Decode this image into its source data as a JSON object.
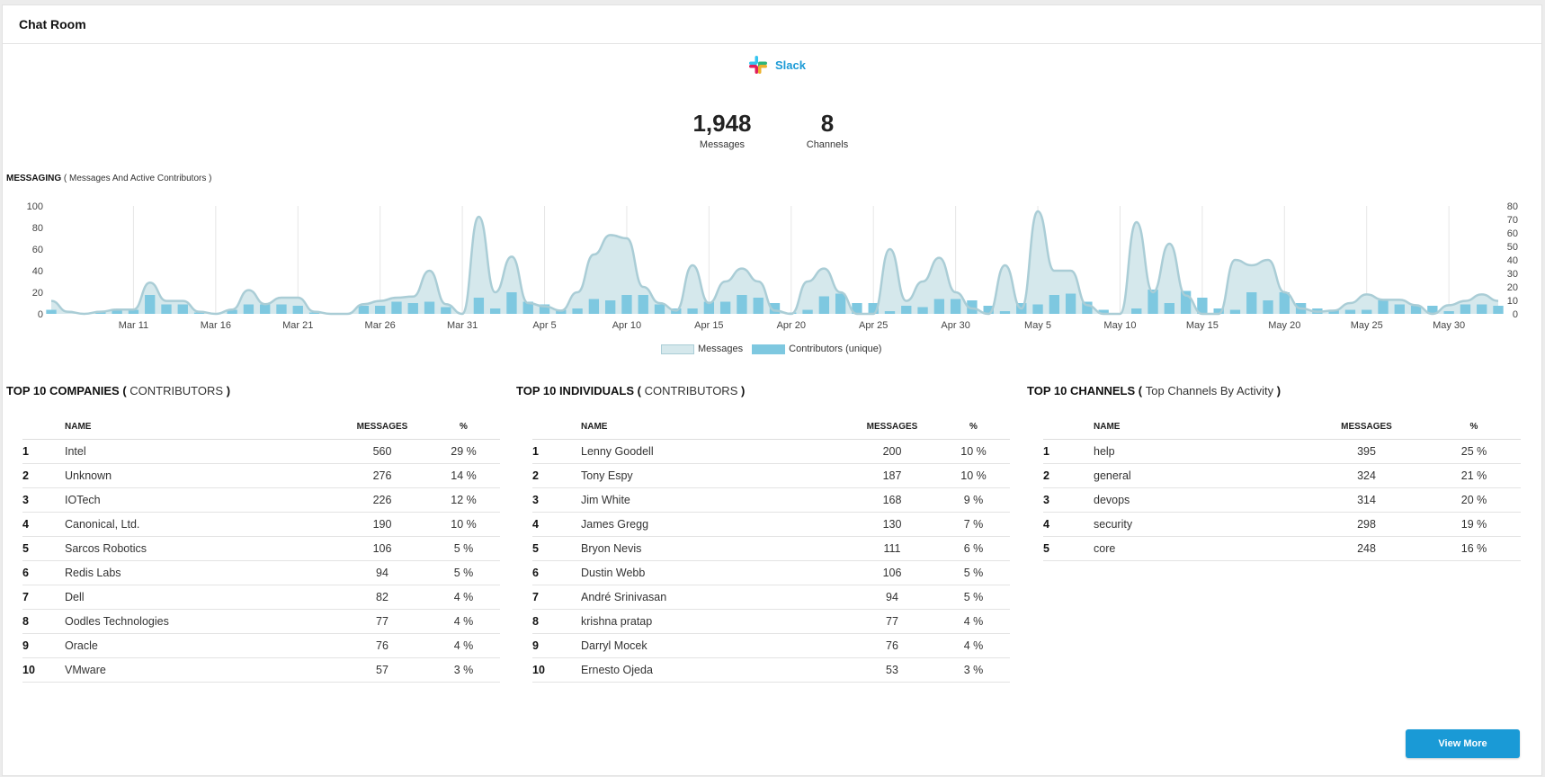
{
  "header": {
    "title": "Chat Room"
  },
  "source": {
    "name": "Slack",
    "icon": "slack-logo-icon"
  },
  "stats": [
    {
      "value": "1,948",
      "label": "Messages"
    },
    {
      "value": "8",
      "label": "Channels"
    }
  ],
  "messaging": {
    "title": "MESSAGING",
    "paren_open": "(",
    "subtitle": "Messages And Active Contributors",
    "paren_close": ")"
  },
  "legend": {
    "messages": "Messages",
    "contributors": "Contributors (unique)"
  },
  "colors": {
    "area_fill": "#d5e8ec",
    "area_stroke": "#aacdd6",
    "bar": "#7ec8e0",
    "accent": "#1a9ad6"
  },
  "chart_data": {
    "type": "bar",
    "title": "",
    "x_tick_labels": [
      "Mar 11",
      "Mar 16",
      "Mar 21",
      "Mar 26",
      "Mar 31",
      "Apr 5",
      "Apr 10",
      "Apr 15",
      "Apr 20",
      "Apr 25",
      "Apr 30",
      "May 5",
      "May 10",
      "May 15",
      "May 20",
      "May 25",
      "May 30"
    ],
    "y_left": {
      "ticks": [
        0,
        20,
        40,
        60,
        80,
        100
      ],
      "range": [
        0,
        100
      ]
    },
    "y_right": {
      "ticks": [
        0,
        10,
        20,
        30,
        40,
        50,
        60,
        70,
        80
      ],
      "range": [
        0,
        80
      ]
    },
    "x_start": "Mar 6",
    "series": [
      {
        "name": "Messages",
        "type": "area",
        "axis": "left",
        "values": [
          12,
          2,
          0,
          2,
          4,
          4,
          29,
          12,
          12,
          2,
          0,
          4,
          22,
          9,
          15,
          15,
          2,
          0,
          0,
          9,
          12,
          15,
          16,
          40,
          9,
          0,
          90,
          20,
          53,
          10,
          7,
          3,
          20,
          55,
          73,
          70,
          25,
          10,
          3,
          45,
          10,
          30,
          42,
          30,
          3,
          0,
          30,
          42,
          20,
          0,
          0,
          60,
          12,
          30,
          52,
          20,
          5,
          0,
          45,
          5,
          95,
          40,
          40,
          8,
          0,
          0,
          85,
          20,
          65,
          17,
          0,
          0,
          50,
          45,
          50,
          20,
          5,
          2,
          3,
          10,
          18,
          13,
          13,
          8,
          0,
          8,
          12,
          18,
          12
        ]
      },
      {
        "name": "Contributors (unique)",
        "type": "bar",
        "axis": "right",
        "values": [
          3,
          0,
          0,
          2,
          3,
          3,
          14,
          7,
          7,
          1,
          0,
          3,
          7,
          7,
          7,
          6,
          1,
          0,
          0,
          6,
          6,
          9,
          8,
          9,
          5,
          0,
          12,
          4,
          16,
          9,
          7,
          3,
          4,
          11,
          10,
          14,
          14,
          7,
          4,
          4,
          9,
          9,
          14,
          12,
          8,
          1,
          3,
          13,
          15,
          8,
          8,
          2,
          6,
          5,
          11,
          11,
          10,
          6,
          2,
          8,
          7,
          14,
          15,
          9,
          3,
          0,
          4,
          18,
          8,
          17,
          12,
          4,
          3,
          16,
          10,
          16,
          8,
          4,
          3,
          3,
          3,
          10,
          7,
          6,
          6,
          2,
          7,
          7,
          6
        ]
      }
    ]
  },
  "companies": {
    "title": "TOP 10 COMPANIES",
    "paren_open": "(",
    "subtitle": "CONTRIBUTORS",
    "paren_close": ")",
    "headers": {
      "name": "NAME",
      "messages": "MESSAGES",
      "pct": "%"
    },
    "rows": [
      {
        "rank": "1",
        "name": "Intel",
        "messages": "560",
        "pct": "29 %"
      },
      {
        "rank": "2",
        "name": "Unknown",
        "messages": "276",
        "pct": "14 %"
      },
      {
        "rank": "3",
        "name": "IOTech",
        "messages": "226",
        "pct": "12 %"
      },
      {
        "rank": "4",
        "name": "Canonical, Ltd.",
        "messages": "190",
        "pct": "10 %"
      },
      {
        "rank": "5",
        "name": "Sarcos Robotics",
        "messages": "106",
        "pct": "5 %"
      },
      {
        "rank": "6",
        "name": "Redis Labs",
        "messages": "94",
        "pct": "5 %"
      },
      {
        "rank": "7",
        "name": "Dell",
        "messages": "82",
        "pct": "4 %"
      },
      {
        "rank": "8",
        "name": "Oodles Technologies",
        "messages": "77",
        "pct": "4 %"
      },
      {
        "rank": "9",
        "name": "Oracle",
        "messages": "76",
        "pct": "4 %"
      },
      {
        "rank": "10",
        "name": "VMware",
        "messages": "57",
        "pct": "3 %"
      }
    ]
  },
  "individuals": {
    "title": "TOP 10 INDIVIDUALS",
    "paren_open": "(",
    "subtitle": "CONTRIBUTORS",
    "paren_close": ")",
    "headers": {
      "name": "NAME",
      "messages": "MESSAGES",
      "pct": "%"
    },
    "rows": [
      {
        "rank": "1",
        "name": "Lenny Goodell",
        "messages": "200",
        "pct": "10 %"
      },
      {
        "rank": "2",
        "name": "Tony Espy",
        "messages": "187",
        "pct": "10 %"
      },
      {
        "rank": "3",
        "name": "Jim White",
        "messages": "168",
        "pct": "9 %"
      },
      {
        "rank": "4",
        "name": "James Gregg",
        "messages": "130",
        "pct": "7 %"
      },
      {
        "rank": "5",
        "name": "Bryon Nevis",
        "messages": "111",
        "pct": "6 %"
      },
      {
        "rank": "6",
        "name": "Dustin Webb",
        "messages": "106",
        "pct": "5 %"
      },
      {
        "rank": "7",
        "name": "André Srinivasan",
        "messages": "94",
        "pct": "5 %"
      },
      {
        "rank": "8",
        "name": "krishna pratap",
        "messages": "77",
        "pct": "4 %"
      },
      {
        "rank": "9",
        "name": "Darryl Mocek",
        "messages": "76",
        "pct": "4 %"
      },
      {
        "rank": "10",
        "name": "Ernesto Ojeda",
        "messages": "53",
        "pct": "3 %"
      }
    ]
  },
  "channels": {
    "title": "TOP 10 CHANNELS",
    "paren_open": "(",
    "subtitle": "Top Channels By Activity",
    "paren_close": ")",
    "headers": {
      "name": "NAME",
      "messages": "MESSAGES",
      "pct": "%"
    },
    "rows": [
      {
        "rank": "1",
        "name": "help",
        "messages": "395",
        "pct": "25 %"
      },
      {
        "rank": "2",
        "name": "general",
        "messages": "324",
        "pct": "21 %"
      },
      {
        "rank": "3",
        "name": "devops",
        "messages": "314",
        "pct": "20 %"
      },
      {
        "rank": "4",
        "name": "security",
        "messages": "298",
        "pct": "19 %"
      },
      {
        "rank": "5",
        "name": "core",
        "messages": "248",
        "pct": "16 %"
      }
    ]
  },
  "view_more": "View More"
}
